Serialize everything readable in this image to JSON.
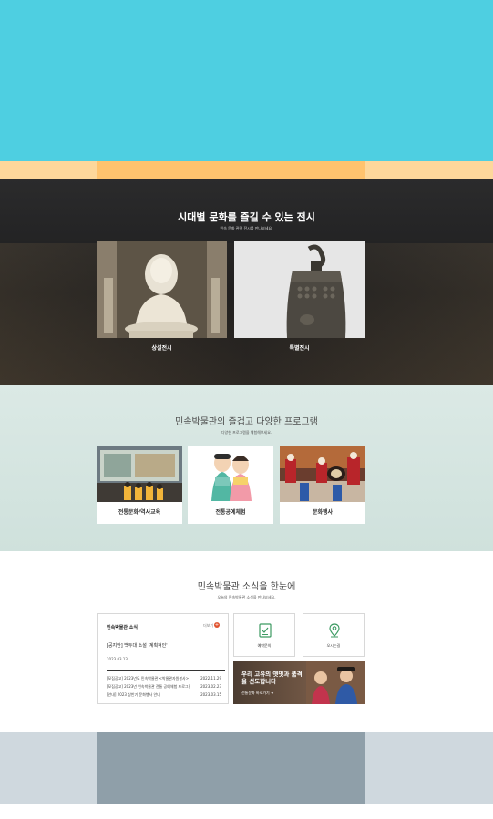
{
  "colors": {
    "hero": "#4ecfe1",
    "stripe": "#fdd79b",
    "stripe_center": "#ffc36e",
    "exhibit_bg": "#1f1f20",
    "program_bg": "#d6e6e1",
    "footer": "#cfd8de",
    "footer_center": "#8f9fa9"
  },
  "exhibitions": {
    "title": "시대별 문화를 즐길 수 있는 전시",
    "subtitle": "민속 문화 관련 전시를 만나보세요.",
    "cards": [
      {
        "label": "상설전시",
        "image": "buddha-statue"
      },
      {
        "label": "특별전시",
        "image": "bronze-bell"
      }
    ]
  },
  "programs": {
    "title": "민속박물관의 즐겁고 다양한 프로그램",
    "subtitle": "다양한 프로그램을 체험해보세요.",
    "cards": [
      {
        "label": "전통문화/역사교육",
        "image": "children-museum-tour"
      },
      {
        "label": "전통공예체험",
        "image": "traditional-dolls"
      },
      {
        "label": "문화행사",
        "image": "traditional-drum-performance"
      }
    ]
  },
  "news": {
    "title": "민속박물관 소식을 한눈에",
    "subtitle": "오늘의 민속박물관 소식을 만나보세요.",
    "box": {
      "heading": "민속박물관 소식",
      "more": "더보기",
      "featured": "[공지안] 백두대 소설 '계획적인'",
      "featured_date": "2023.03.13",
      "items": [
        {
          "title": "[모집공고] 2023년도 민속박물관 <박물관자원봉사> 1...",
          "date": "2022.11.29"
        },
        {
          "title": "[모집공고] 2023년 민속박물관 전통 공예체험 프로그램 모집",
          "date": "2023.02.23"
        },
        {
          "title": "[안내] 2023 상반기 문화행사 안내",
          "date": "2023.03.15"
        }
      ]
    },
    "quick_links": [
      {
        "label": "예약문의",
        "icon": "reservation-doc-icon"
      },
      {
        "label": "오시는길",
        "icon": "location-pin-icon"
      }
    ],
    "banner": {
      "text": "우리 고유의 옛멋과 품격을 선도합니다",
      "link": "전통문화 바로가기 →"
    }
  }
}
